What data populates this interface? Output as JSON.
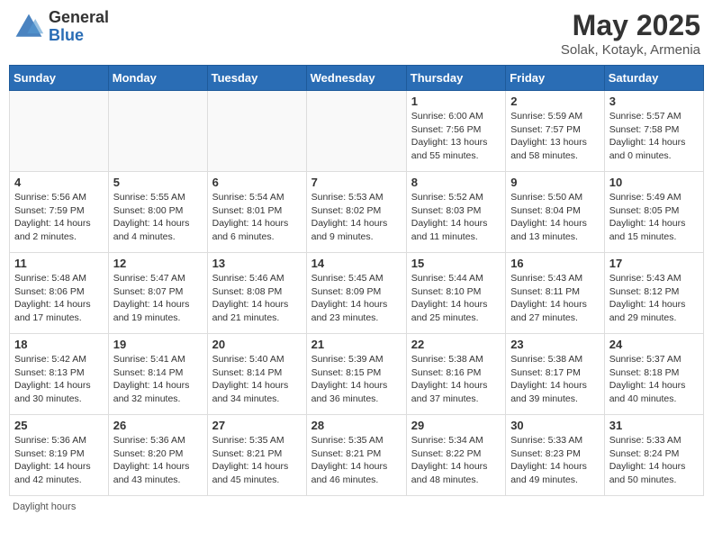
{
  "header": {
    "logo_general": "General",
    "logo_blue": "Blue",
    "title": "May 2025",
    "location": "Solak, Kotayk, Armenia"
  },
  "days_of_week": [
    "Sunday",
    "Monday",
    "Tuesday",
    "Wednesday",
    "Thursday",
    "Friday",
    "Saturday"
  ],
  "footer": {
    "note": "Daylight hours"
  },
  "weeks": [
    {
      "days": [
        {
          "number": "",
          "info": ""
        },
        {
          "number": "",
          "info": ""
        },
        {
          "number": "",
          "info": ""
        },
        {
          "number": "",
          "info": ""
        },
        {
          "number": "1",
          "info": "Sunrise: 6:00 AM\nSunset: 7:56 PM\nDaylight: 13 hours\nand 55 minutes."
        },
        {
          "number": "2",
          "info": "Sunrise: 5:59 AM\nSunset: 7:57 PM\nDaylight: 13 hours\nand 58 minutes."
        },
        {
          "number": "3",
          "info": "Sunrise: 5:57 AM\nSunset: 7:58 PM\nDaylight: 14 hours\nand 0 minutes."
        }
      ]
    },
    {
      "days": [
        {
          "number": "4",
          "info": "Sunrise: 5:56 AM\nSunset: 7:59 PM\nDaylight: 14 hours\nand 2 minutes."
        },
        {
          "number": "5",
          "info": "Sunrise: 5:55 AM\nSunset: 8:00 PM\nDaylight: 14 hours\nand 4 minutes."
        },
        {
          "number": "6",
          "info": "Sunrise: 5:54 AM\nSunset: 8:01 PM\nDaylight: 14 hours\nand 6 minutes."
        },
        {
          "number": "7",
          "info": "Sunrise: 5:53 AM\nSunset: 8:02 PM\nDaylight: 14 hours\nand 9 minutes."
        },
        {
          "number": "8",
          "info": "Sunrise: 5:52 AM\nSunset: 8:03 PM\nDaylight: 14 hours\nand 11 minutes."
        },
        {
          "number": "9",
          "info": "Sunrise: 5:50 AM\nSunset: 8:04 PM\nDaylight: 14 hours\nand 13 minutes."
        },
        {
          "number": "10",
          "info": "Sunrise: 5:49 AM\nSunset: 8:05 PM\nDaylight: 14 hours\nand 15 minutes."
        }
      ]
    },
    {
      "days": [
        {
          "number": "11",
          "info": "Sunrise: 5:48 AM\nSunset: 8:06 PM\nDaylight: 14 hours\nand 17 minutes."
        },
        {
          "number": "12",
          "info": "Sunrise: 5:47 AM\nSunset: 8:07 PM\nDaylight: 14 hours\nand 19 minutes."
        },
        {
          "number": "13",
          "info": "Sunrise: 5:46 AM\nSunset: 8:08 PM\nDaylight: 14 hours\nand 21 minutes."
        },
        {
          "number": "14",
          "info": "Sunrise: 5:45 AM\nSunset: 8:09 PM\nDaylight: 14 hours\nand 23 minutes."
        },
        {
          "number": "15",
          "info": "Sunrise: 5:44 AM\nSunset: 8:10 PM\nDaylight: 14 hours\nand 25 minutes."
        },
        {
          "number": "16",
          "info": "Sunrise: 5:43 AM\nSunset: 8:11 PM\nDaylight: 14 hours\nand 27 minutes."
        },
        {
          "number": "17",
          "info": "Sunrise: 5:43 AM\nSunset: 8:12 PM\nDaylight: 14 hours\nand 29 minutes."
        }
      ]
    },
    {
      "days": [
        {
          "number": "18",
          "info": "Sunrise: 5:42 AM\nSunset: 8:13 PM\nDaylight: 14 hours\nand 30 minutes."
        },
        {
          "number": "19",
          "info": "Sunrise: 5:41 AM\nSunset: 8:14 PM\nDaylight: 14 hours\nand 32 minutes."
        },
        {
          "number": "20",
          "info": "Sunrise: 5:40 AM\nSunset: 8:14 PM\nDaylight: 14 hours\nand 34 minutes."
        },
        {
          "number": "21",
          "info": "Sunrise: 5:39 AM\nSunset: 8:15 PM\nDaylight: 14 hours\nand 36 minutes."
        },
        {
          "number": "22",
          "info": "Sunrise: 5:38 AM\nSunset: 8:16 PM\nDaylight: 14 hours\nand 37 minutes."
        },
        {
          "number": "23",
          "info": "Sunrise: 5:38 AM\nSunset: 8:17 PM\nDaylight: 14 hours\nand 39 minutes."
        },
        {
          "number": "24",
          "info": "Sunrise: 5:37 AM\nSunset: 8:18 PM\nDaylight: 14 hours\nand 40 minutes."
        }
      ]
    },
    {
      "days": [
        {
          "number": "25",
          "info": "Sunrise: 5:36 AM\nSunset: 8:19 PM\nDaylight: 14 hours\nand 42 minutes."
        },
        {
          "number": "26",
          "info": "Sunrise: 5:36 AM\nSunset: 8:20 PM\nDaylight: 14 hours\nand 43 minutes."
        },
        {
          "number": "27",
          "info": "Sunrise: 5:35 AM\nSunset: 8:21 PM\nDaylight: 14 hours\nand 45 minutes."
        },
        {
          "number": "28",
          "info": "Sunrise: 5:35 AM\nSunset: 8:21 PM\nDaylight: 14 hours\nand 46 minutes."
        },
        {
          "number": "29",
          "info": "Sunrise: 5:34 AM\nSunset: 8:22 PM\nDaylight: 14 hours\nand 48 minutes."
        },
        {
          "number": "30",
          "info": "Sunrise: 5:33 AM\nSunset: 8:23 PM\nDaylight: 14 hours\nand 49 minutes."
        },
        {
          "number": "31",
          "info": "Sunrise: 5:33 AM\nSunset: 8:24 PM\nDaylight: 14 hours\nand 50 minutes."
        }
      ]
    }
  ]
}
